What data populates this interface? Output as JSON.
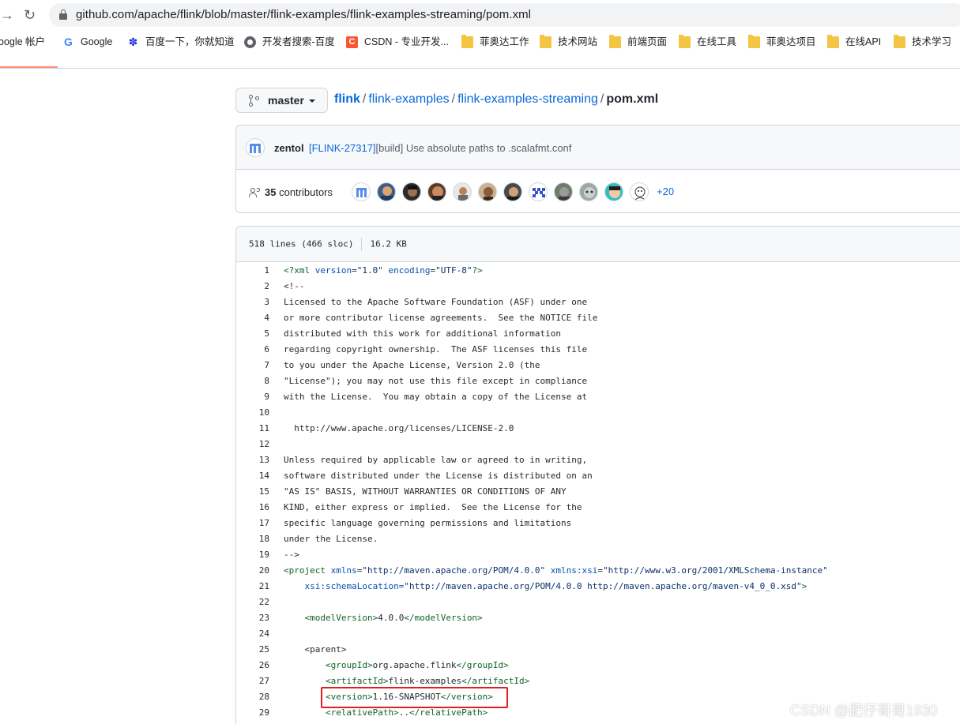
{
  "browser": {
    "url": "github.com/apache/flink/blob/master/flink-examples/flink-examples-streaming/pom.xml",
    "bookmarks": [
      {
        "label": "oogle 帐户",
        "icon": "none"
      },
      {
        "label": "Google",
        "icon": "google-icon"
      },
      {
        "label": "百度一下，你就知道",
        "icon": "baidu-icon"
      },
      {
        "label": "开发者搜索-百度",
        "icon": "globe-icon"
      },
      {
        "label": "CSDN - 专业开发...",
        "icon": "csdn-icon"
      },
      {
        "label": "菲奥达工作",
        "icon": "folder-icon"
      },
      {
        "label": "技术网站",
        "icon": "folder-icon"
      },
      {
        "label": "前端页面",
        "icon": "folder-icon"
      },
      {
        "label": "在线工具",
        "icon": "folder-icon"
      },
      {
        "label": "菲奥达项目",
        "icon": "folder-icon"
      },
      {
        "label": "在线API",
        "icon": "folder-icon"
      },
      {
        "label": "技术学习",
        "icon": "folder-icon"
      }
    ]
  },
  "repo": {
    "branch": "master",
    "path": {
      "repo": "flink",
      "dir1": "flink-examples",
      "dir2": "flink-examples-streaming",
      "file": "pom.xml",
      "sep": "/"
    }
  },
  "commit": {
    "author": "zentol",
    "issue": "[FLINK-27317]",
    "message": "[build] Use absolute paths to .scalafmt.conf",
    "contributors_count": "35",
    "contributors_label": "contributors",
    "more_contributors": "+20"
  },
  "file": {
    "lines": "518 lines (466 sloc)",
    "size": "16.2 KB"
  },
  "code_lines": [
    "1",
    "2",
    "3",
    "4",
    "5",
    "6",
    "7",
    "8",
    "9",
    "10",
    "11",
    "12",
    "13",
    "14",
    "15",
    "16",
    "17",
    "18",
    "19",
    "20",
    "21",
    "22",
    "23",
    "24",
    "25",
    "26",
    "27",
    "28",
    "29"
  ],
  "code": {
    "l1": {
      "a": "<?xml ",
      "b": "version",
      "c": "=",
      "d": "\"1.0\"",
      "e": " ",
      "f": "encoding",
      "g": "=",
      "h": "\"UTF-8\"",
      "i": "?>"
    },
    "l2": "<!--",
    "l3": "Licensed to the Apache Software Foundation (ASF) under one",
    "l4": "or more contributor license agreements.  See the NOTICE file",
    "l5": "distributed with this work for additional information",
    "l6": "regarding copyright ownership.  The ASF licenses this file",
    "l7": "to you under the Apache License, Version 2.0 (the",
    "l8": "\"License\"); you may not use this file except in compliance",
    "l9": "with the License.  You may obtain a copy of the License at",
    "l10": "",
    "l11": "  http://www.apache.org/licenses/LICENSE-2.0",
    "l12": "",
    "l13": "Unless required by applicable law or agreed to in writing,",
    "l14": "software distributed under the License is distributed on an",
    "l15": "\"AS IS\" BASIS, WITHOUT WARRANTIES OR CONDITIONS OF ANY",
    "l16": "KIND, either express or implied.  See the License for the",
    "l17": "specific language governing permissions and limitations",
    "l18": "under the License.",
    "l19": "-->",
    "l20": {
      "a": "<project ",
      "b": "xmlns",
      "c": "=",
      "d": "\"http://maven.apache.org/POM/4.0.0\"",
      "e": " ",
      "f": "xmlns:xsi",
      "g": "=",
      "h": "\"http://www.w3.org/2001/XMLSchema-instance\""
    },
    "l21": {
      "a": "    xsi:schemaLocation=",
      "b": "\"http://maven.apache.org/POM/4.0.0 http://maven.apache.org/maven-v4_0_0.xsd\"",
      "c": ">"
    },
    "l22": "",
    "l23": {
      "open": "    <modelVersion>",
      "val": "4.0.0",
      "close": "</modelVersion>"
    },
    "l24": "",
    "l25": "    <parent>",
    "l26": {
      "open": "        <groupId>",
      "val": "org.apache.flink",
      "close": "</groupId>"
    },
    "l27": {
      "open": "        <artifactId>",
      "val": "flink-examples",
      "close": "</artifactId>"
    },
    "l28": {
      "open": "        <version>",
      "val": "1.16-SNAPSHOT",
      "close": "</version>"
    },
    "l29": {
      "open": "        <relativePath>",
      "val": "..",
      "close": "</relativePath>"
    }
  },
  "watermark": "CSDN @肥仔哥哥1930",
  "colors": {
    "link": "#0969da",
    "highlight": "#e02020",
    "comment": "#6e7781"
  }
}
